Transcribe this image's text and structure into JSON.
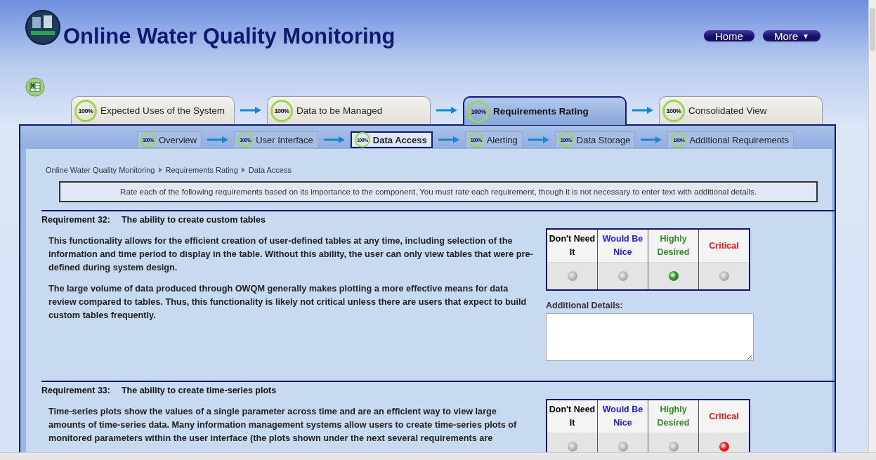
{
  "header": {
    "title": "Online Water Quality Monitoring",
    "buttons": [
      {
        "label": "Home",
        "kind": "plain"
      },
      {
        "label": "More",
        "caret": "▼",
        "kind": "menu"
      }
    ]
  },
  "main_tabs": [
    {
      "percent": "100%",
      "label": "Expected Uses of the System",
      "selected": false
    },
    {
      "percent": "100%",
      "label": "Data to be Managed",
      "selected": false
    },
    {
      "percent": "100%",
      "label": "Requirements Rating",
      "selected": true
    },
    {
      "percent": "100%",
      "label": "Consolidated View",
      "selected": false
    }
  ],
  "sub_tabs": [
    {
      "percent": "100%",
      "label": "Overview",
      "selected": false
    },
    {
      "percent": "100%",
      "label": "User Interface",
      "selected": false
    },
    {
      "percent": "100%",
      "label": "Data Access",
      "selected": true
    },
    {
      "percent": "100%",
      "label": "Alerting",
      "selected": false
    },
    {
      "percent": "100%",
      "label": "Data Storage",
      "selected": false
    },
    {
      "percent": "100%",
      "label": "Additional Requirements",
      "selected": false
    }
  ],
  "breadcrumb": [
    "Online Water Quality Monitoring",
    "Requirements Rating",
    "Data Access"
  ],
  "instructions": "Rate each of the following requirements based on its importance to the component. You must rate each requirement, though it is not necessary to enter text with additional details.",
  "requirements": [
    {
      "number": "Requirement 32:",
      "title": "The ability to create custom tables",
      "paragraphs": [
        "This functionality allows for the efficient creation of user-defined tables at any time, including selection of the information and time period to display in the table. Without this ability, the user can only view tables that were pre-defined during system design.",
        "The large volume of data produced through OWQM generally makes plotting a more effective means for data review compared to tables. Thus, this functionality is likely not critical unless there are users that expect to build custom tables frequently."
      ],
      "ratings": [
        {
          "label": "Don't Need It",
          "color": "#000000",
          "selected": false
        },
        {
          "label": "Would Be Nice",
          "color": "#1a1aee",
          "selected": false
        },
        {
          "label": "Highly Desired",
          "color": "#2e8b22",
          "selected": true
        },
        {
          "label": "Critical",
          "color": "#ee1111",
          "selected": false
        }
      ],
      "details_label": "Additional Details:"
    },
    {
      "number": "Requirement 33:",
      "title": "The ability to create time-series plots",
      "paragraphs": [
        "Time-series plots show the values of a single parameter across time and are an efficient way to view large amounts of time-series data. Many information management systems allow users to create time-series plots of monitored parameters within the user interface (the plots shown under the next several requirements are"
      ],
      "ratings": [
        {
          "label": "Don't Need It",
          "color": "#000000",
          "selected": false
        },
        {
          "label": "Would Be Nice",
          "color": "#1a1aee",
          "selected": false
        },
        {
          "label": "Highly Desired",
          "color": "#2e8b22",
          "selected": false
        },
        {
          "label": "Critical",
          "color": "#ee1111",
          "selected": true
        }
      ]
    }
  ]
}
